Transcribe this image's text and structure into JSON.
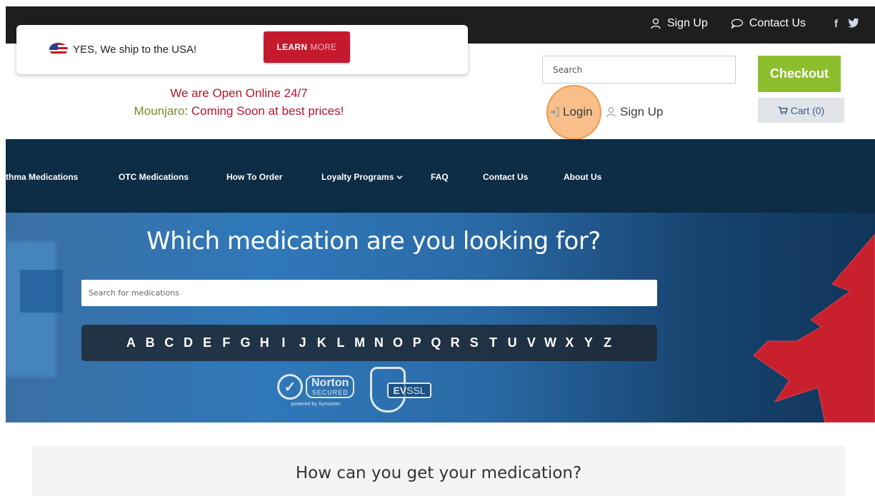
{
  "topbar": {
    "signup_label": "Sign Up",
    "contact_label": "Contact Us",
    "social_facebook": "f",
    "social_twitter": "t"
  },
  "banner": {
    "ship_text": "YES, We ship to the USA!",
    "learn_bold": "LEARN",
    "learn_more": "MORE"
  },
  "promo": {
    "line1": "We are Open Online 24/7",
    "line2_product": "Mounjaro",
    "line2_rest": ": Coming Soon at best prices!"
  },
  "header": {
    "search_placeholder": "Search",
    "checkout_label": "Checkout",
    "cart_label": "Cart (0)",
    "login_label": "Login",
    "signup_label": "Sign Up"
  },
  "nav": {
    "items": [
      {
        "label": "thma Medications"
      },
      {
        "label": "OTC Medications"
      },
      {
        "label": "How To Order"
      },
      {
        "label": "Loyalty Programs"
      },
      {
        "label": "FAQ"
      },
      {
        "label": "Contact Us"
      },
      {
        "label": "About Us"
      }
    ]
  },
  "hero": {
    "title": "Which medication are you looking for?",
    "search_placeholder": "Search for medications",
    "letters": [
      "A",
      "B",
      "C",
      "D",
      "E",
      "F",
      "G",
      "H",
      "I",
      "J",
      "K",
      "L",
      "M",
      "N",
      "O",
      "P",
      "Q",
      "R",
      "S",
      "T",
      "U",
      "V",
      "W",
      "X",
      "Y",
      "Z"
    ],
    "norton_name": "Norton",
    "norton_secured": "SECURED",
    "norton_powered": "powered by Symantec",
    "ev_label": "EV",
    "ssl_label": "SSL"
  },
  "section": {
    "title": "How can you get your medication?"
  },
  "colors": {
    "topbar_bg": "#1e1e1e",
    "nav_bg": "#0d2c45",
    "learn_btn": "#c5192d",
    "checkout_btn": "#8cbe2d",
    "promo_red": "#b5172a",
    "promo_olive": "#7a8a2a",
    "highlight": "#f5aa64"
  },
  "icons": {
    "user": "user-icon",
    "chat": "chat-bubble-icon",
    "facebook": "facebook-icon",
    "twitter": "twitter-icon",
    "flag": "usa-flag-icon",
    "cart": "cart-icon",
    "login": "login-icon",
    "chevron": "chevron-down-icon",
    "maple": "maple-leaf-icon"
  }
}
